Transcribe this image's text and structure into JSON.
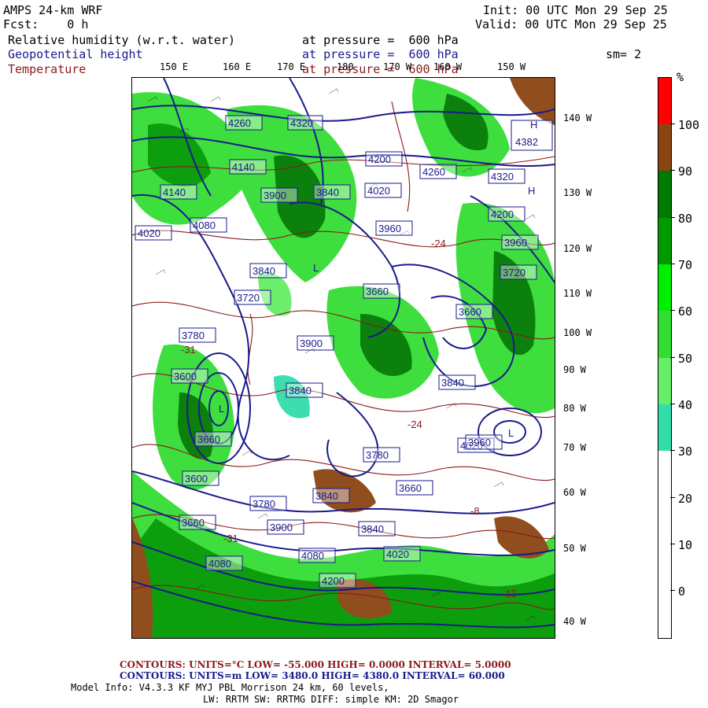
{
  "header": {
    "model": "AMPS 24-km WRF",
    "fcst": "Fcst:    0 h",
    "init": "Init: 00 UTC Mon 29 Sep 25",
    "valid": "Valid: 00 UTC Mon 29 Sep 25"
  },
  "fields": [
    {
      "name": "Relative humidity (w.r.t. water)",
      "level": "at pressure =  600 hPa",
      "color": "#000000"
    },
    {
      "name": "Geopotential height",
      "level": "at pressure =  600 hPa",
      "color": "#1a1a8c"
    },
    {
      "name": "Temperature",
      "level": "at pressure =  600 hPa",
      "color": "#8b1a1a"
    }
  ],
  "smoothing": "sm= 2",
  "lon_labels": [
    "150 E",
    "160 E",
    "170 E",
    "180",
    "170 W",
    "160 W",
    "150 W"
  ],
  "lat_labels": [
    "140 W",
    "130 W",
    "120 W",
    "110 W",
    "100 W",
    "90 W",
    "80 W",
    "70 W",
    "60 W",
    "50 W",
    "40 W"
  ],
  "height_labels": [
    "4260",
    "4320",
    "4140",
    "4200",
    "4260",
    "4320",
    "4140",
    "3900",
    "3840",
    "4020",
    "4080",
    "4200",
    "4020",
    "3960",
    "3720",
    "3840",
    "3660",
    "3660",
    "3720",
    "3600",
    "3840",
    "3780",
    "3900",
    "3660",
    "4020",
    "3600",
    "3780",
    "3660",
    "3840",
    "3780",
    "3900",
    "3840",
    "3660",
    "3960",
    "3840",
    "4080",
    "4020",
    "4080",
    "4200",
    "3960",
    "4382"
  ],
  "temp_labels": [
    "-8",
    "-24",
    "-24",
    "-31",
    "-13",
    "-31"
  ],
  "colorbar": {
    "unit": "%",
    "labels": [
      "100",
      "90",
      "80",
      "70",
      "60",
      "50",
      "40",
      "30",
      "20",
      "10",
      "0"
    ],
    "colors": [
      "#ff0000",
      "#8b4513",
      "#007a00",
      "#009900",
      "#00ee00",
      "#33dd33",
      "#66ee66",
      "#33ddaa",
      "#ffffff",
      "#ffffff",
      "#ffffff",
      "#ffffff"
    ]
  },
  "footer": {
    "line1_label": "CONTOURS:  UNITS=°C  LOW= -55.000      HIGH=  0.0000      INTERVAL=   5.0000",
    "line2_label": "CONTOURS:  UNITS=m  LOW=  3480.0      HIGH=  4380.0      INTERVAL=   60.000",
    "line3": "Model Info: V4.3.3    KF     MYJ PBL  Morrison        24 km,    60 levels,",
    "line4": "LW: RRTM SW: RRTMG   DIFF: simple KM: 2D Smagor"
  }
}
